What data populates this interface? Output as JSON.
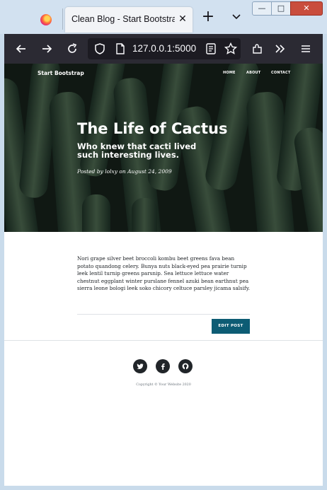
{
  "browser": {
    "tab_title": "Clean Blog - Start Bootstrap",
    "url": "127.0.0.1:5000",
    "window_controls": {
      "minimize": "—",
      "maximize": "□",
      "close": "✕"
    }
  },
  "site": {
    "brand": "Start Bootstrap",
    "nav": [
      "HOME",
      "ABOUT",
      "CONTACT"
    ]
  },
  "post": {
    "title": "The Life of Cactus",
    "subtitle": "Who knew that cacti lived such interesting lives.",
    "meta_prefix": "Posted by",
    "author": "lolxy",
    "meta_on": "on",
    "date": "August 24, 2009",
    "body": "Nori grape silver beet broccoli kombu beet greens fava bean potato quandong celery. Bunya nuts black-eyed pea prairie turnip leek lentil turnip greens parsnip. Sea lettuce lettuce water chestnut eggplant winter purslane fennel azuki bean earthnut pea sierra leone bologi leek soko chicory celtuce parsley jicama salsify.",
    "edit_button": "EDIT POST"
  },
  "footer": {
    "social_icons": [
      "twitter-icon",
      "facebook-icon",
      "github-icon"
    ],
    "copyright": "Copyright © Your Website 2020"
  },
  "colors": {
    "toolbar": "#2b2a33",
    "edit_button": "#0d5c74",
    "tabstrip": "#d2e1f0"
  }
}
